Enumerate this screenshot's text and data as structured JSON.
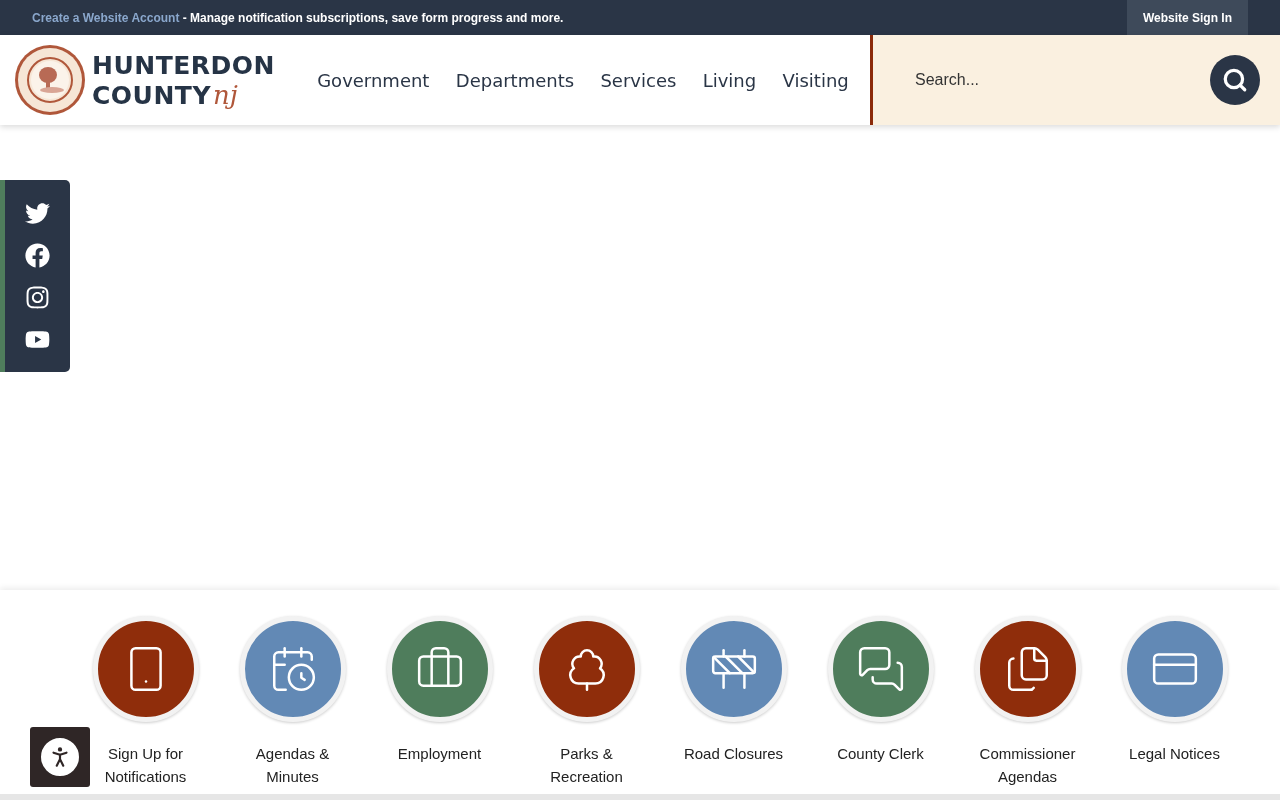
{
  "top_bar": {
    "link": "Create a Website Account",
    "message": " - Manage notification subscriptions, save form progress and more.",
    "sign_in": "Website Sign In"
  },
  "logo": {
    "line1": "HUNTERDON",
    "line2": "COUNTY",
    "script": "nj"
  },
  "nav": [
    "Government",
    "Departments",
    "Services",
    "Living",
    "Visiting"
  ],
  "search": {
    "placeholder": "Search..."
  },
  "social": [
    {
      "kind": "twitter"
    },
    {
      "kind": "facebook"
    },
    {
      "kind": "instagram"
    },
    {
      "kind": "youtube"
    }
  ],
  "quick_links": [
    {
      "label": "Sign Up for Notifications",
      "kind": "phone",
      "color": "#8f2d0b"
    },
    {
      "label": "Agendas & Minutes",
      "kind": "calendar",
      "color": "#6289b5"
    },
    {
      "label": "Employment",
      "kind": "briefcase",
      "color": "#4f7d5c"
    },
    {
      "label": "Parks & Recreation",
      "kind": "park",
      "color": "#8f2d0b"
    },
    {
      "label": "Road Closures",
      "kind": "barrier",
      "color": "#6289b5"
    },
    {
      "label": "County Clerk",
      "kind": "chat",
      "color": "#4f7d5c"
    },
    {
      "label": "Commissioner Agendas",
      "kind": "documents",
      "color": "#8f2d0b"
    },
    {
      "label": "Legal Notices",
      "kind": "cards",
      "color": "#6289b5"
    }
  ]
}
